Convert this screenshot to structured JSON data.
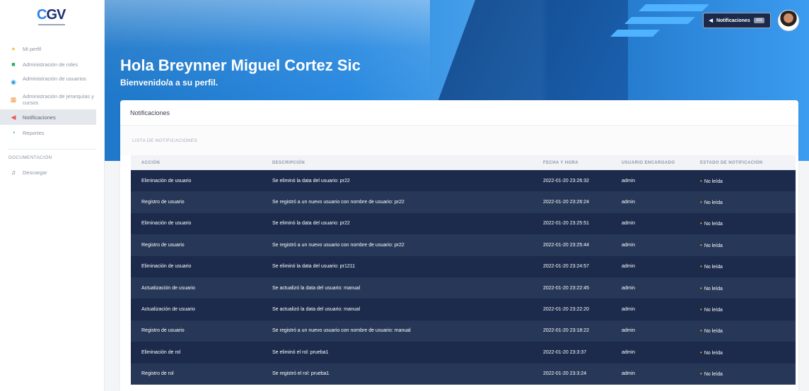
{
  "logo": {
    "text": "CGV"
  },
  "sidebar": {
    "items": [
      {
        "label": "Mi perfil",
        "icon": "user-icon",
        "color": "#f2c94c"
      },
      {
        "label": "Administración de roles",
        "icon": "roles-icon",
        "color": "#27ae60"
      },
      {
        "label": "Administración de usuarios",
        "icon": "users-icon",
        "color": "#2d9cdb"
      },
      {
        "label": "Administración de jerarquías y cursos",
        "icon": "books-icon",
        "color": "#f2994a"
      },
      {
        "label": "Notificaciones",
        "icon": "megaphone-icon",
        "color": "#eb5757",
        "active": true
      },
      {
        "label": "Reportes",
        "icon": "chart-icon",
        "color": "#2d9cdb"
      }
    ],
    "section_title": "DOCUMENTACIÓN",
    "doc_items": [
      {
        "label": "Descargar",
        "icon": "music-icon"
      }
    ]
  },
  "hero": {
    "title": "Hola Breynner Miguel Cortez Sic",
    "subtitle": "Bienvenido/a a su perfil."
  },
  "topbar": {
    "notifications_label": "Notificaciones",
    "notifications_count": "102"
  },
  "card": {
    "title": "Notificaciones",
    "section_title": "LISTA DE NOTIFICACIONES"
  },
  "table": {
    "headers": [
      "ACCIÓN",
      "DESCRIPCIÓN",
      "FECHA Y HORA",
      "USUARIO ENCARGADO",
      "ESTADO DE NOTIFICACIÓN"
    ],
    "rows": [
      {
        "accion": "Eliminación de usuario",
        "descripcion": "Se eliminó la data del usuario: pr22",
        "fecha": "2022-01-20 23:26:32",
        "usuario": "admin",
        "estado": "No leída"
      },
      {
        "accion": "Registro de usuario",
        "descripcion": "Se registró a un nuevo usuario con nombre de usuario: pr22",
        "fecha": "2022-01-20 23:26:24",
        "usuario": "admin",
        "estado": "No leída"
      },
      {
        "accion": "Eliminación de usuario",
        "descripcion": "Se eliminó la data del usuario: pr22",
        "fecha": "2022-01-20 23:25:51",
        "usuario": "admin",
        "estado": "No leída"
      },
      {
        "accion": "Registro de usuario",
        "descripcion": "Se registró a un nuevo usuario con nombre de usuario: pr22",
        "fecha": "2022-01-20 23:25:44",
        "usuario": "admin",
        "estado": "No leída"
      },
      {
        "accion": "Eliminación de usuario",
        "descripcion": "Se eliminó la data del usuario: pr1211",
        "fecha": "2022-01-20 23:24:57",
        "usuario": "admin",
        "estado": "No leída"
      },
      {
        "accion": "Actualización de usuario",
        "descripcion": "Se actualizó la data del usuario: manual",
        "fecha": "2022-01-20 23:22:45",
        "usuario": "admin",
        "estado": "No leída"
      },
      {
        "accion": "Actualización de usuario",
        "descripcion": "Se actualizó la data del usuario: manual",
        "fecha": "2022-01-20 23:22:20",
        "usuario": "admin",
        "estado": "No leída"
      },
      {
        "accion": "Registro de usuario",
        "descripcion": "Se registró a un nuevo usuario con nombre de usuario: manual",
        "fecha": "2022-01-20 23:18:22",
        "usuario": "admin",
        "estado": "No leída"
      },
      {
        "accion": "Eliminación de rol",
        "descripcion": "Se eliminó el rol: prueba1",
        "fecha": "2022-01-20 23:3:37",
        "usuario": "admin",
        "estado": "No leída"
      },
      {
        "accion": "Registro de rol",
        "descripcion": "Se registró el rol: prueba1",
        "fecha": "2022-01-20 23:3:24",
        "usuario": "admin",
        "estado": "No leída"
      }
    ]
  },
  "colors": {
    "row_dark": "#1c2a4b",
    "row_light": "#273757",
    "unread_dot": "#f2a51a",
    "hero_blue": "#2b8ae0"
  }
}
